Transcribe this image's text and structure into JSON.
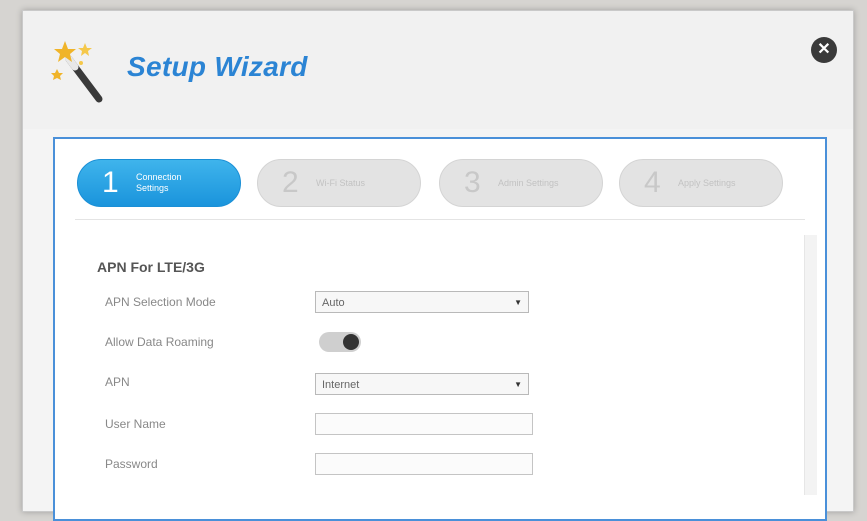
{
  "dialog": {
    "title": "Setup Wizard",
    "close_icon": "close-icon",
    "wand_icon": "magic-wand-icon"
  },
  "steps": [
    {
      "num": "1",
      "label": "Connection Settings",
      "active": true
    },
    {
      "num": "2",
      "label": "Wi-Fi Status",
      "active": false
    },
    {
      "num": "3",
      "label": "Admin Settings",
      "active": false
    },
    {
      "num": "4",
      "label": "Apply Settings",
      "active": false
    }
  ],
  "form": {
    "section_title": "APN For LTE/3G",
    "apn_selection_mode": {
      "label": "APN Selection Mode",
      "value": "Auto"
    },
    "allow_data_roaming": {
      "label": "Allow Data Roaming",
      "state": "on"
    },
    "apn": {
      "label": "APN",
      "value": "Internet"
    },
    "user_name": {
      "label": "User Name",
      "value": ""
    },
    "password": {
      "label": "Password",
      "value": ""
    }
  },
  "colors": {
    "accent": "#2b84d4",
    "active_step": "#1a94dc",
    "panel_border": "#4a90d9"
  }
}
